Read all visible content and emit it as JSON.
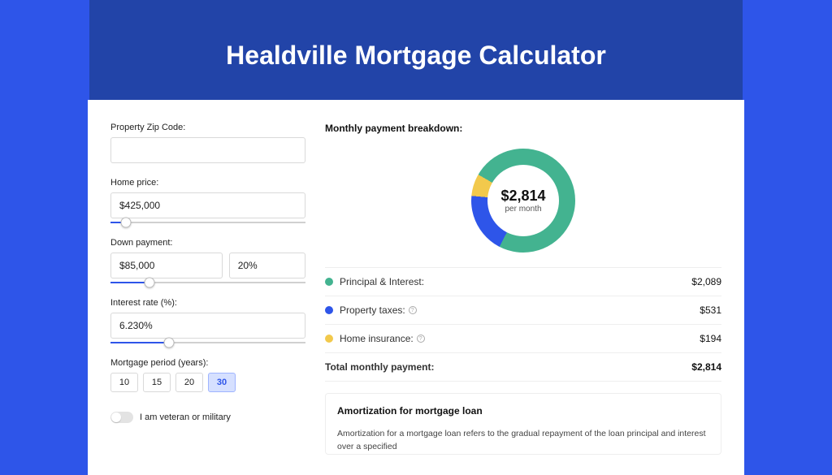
{
  "page": {
    "title": "Healdville Mortgage Calculator"
  },
  "form": {
    "zip": {
      "label": "Property Zip Code:",
      "value": ""
    },
    "price": {
      "label": "Home price:",
      "value": "$425,000",
      "slider_pct": 8
    },
    "down": {
      "label": "Down payment:",
      "amount": "$85,000",
      "percent": "20%",
      "slider_pct": 20
    },
    "rate": {
      "label": "Interest rate (%):",
      "value": "6.230%",
      "slider_pct": 30
    },
    "period": {
      "label": "Mortgage period (years):",
      "options": [
        "10",
        "15",
        "20",
        "30"
      ],
      "selected": 3
    },
    "veteran_label": "I am veteran or military"
  },
  "breakdown": {
    "title": "Monthly payment breakdown:",
    "total_amount": "$2,814",
    "total_sub": "per month",
    "legend": [
      {
        "color": "#43b390",
        "label": "Principal & Interest:",
        "val": "$2,089",
        "info": false
      },
      {
        "color": "#2e55e9",
        "label": "Property taxes:",
        "val": "$531",
        "info": true
      },
      {
        "color": "#f2c94c",
        "label": "Home insurance:",
        "val": "$194",
        "info": true
      }
    ],
    "total_row": {
      "label": "Total monthly payment:",
      "val": "$2,814"
    }
  },
  "amortization": {
    "title": "Amortization for mortgage loan",
    "text": "Amortization for a mortgage loan refers to the gradual repayment of the loan principal and interest over a specified"
  },
  "chart_data": {
    "type": "pie",
    "title": "Monthly payment breakdown",
    "series": [
      {
        "name": "Principal & Interest",
        "value": 2089,
        "color": "#43b390"
      },
      {
        "name": "Property taxes",
        "value": 531,
        "color": "#2e55e9"
      },
      {
        "name": "Home insurance",
        "value": 194,
        "color": "#f2c94c"
      }
    ],
    "total": 2814,
    "unit": "$ per month"
  }
}
